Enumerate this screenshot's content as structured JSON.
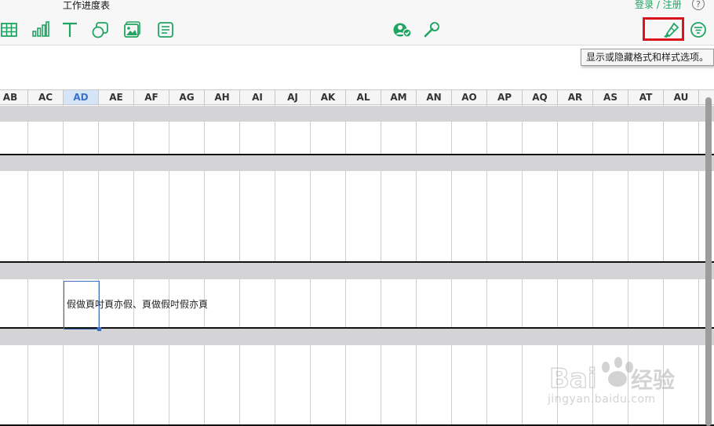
{
  "header": {
    "doc_title": "工作进度表",
    "login_link": "登录 / 注册",
    "help": "?"
  },
  "toolbar": {
    "left_icons": [
      "table-icon",
      "chart-icon",
      "text-icon",
      "shape-icon",
      "media-icon",
      "comment-icon"
    ],
    "center_icons": [
      "collaborate-icon",
      "wrench-icon"
    ],
    "right_icons": [
      "format-brush-icon",
      "filter-icon"
    ],
    "accent_color": "#1fa561",
    "highlight_color": "#d9141a"
  },
  "tooltip": {
    "text": "显示或隐藏格式和样式选项。"
  },
  "sheet": {
    "columns": [
      "AB",
      "AC",
      "AD",
      "AE",
      "AF",
      "AG",
      "AH",
      "AI",
      "AJ",
      "AK",
      "AL",
      "AM",
      "AN",
      "AO",
      "AP",
      "AQ",
      "AR",
      "AS",
      "AT",
      "AU"
    ],
    "selected_column": "AD",
    "selected_cell_text": "假做頁吋頁亦假、頁做假吋假亦頁",
    "band_color": "#d4d4d6",
    "selection_color": "#3f6fb8"
  },
  "watermark": {
    "brand": "Bai经验",
    "url": "jingyan.baidu.com"
  }
}
